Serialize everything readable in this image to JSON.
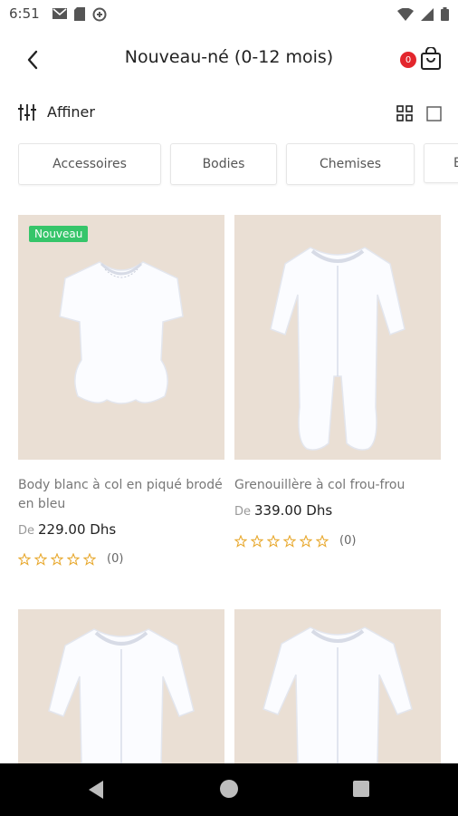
{
  "status_bar": {
    "time": "6:51"
  },
  "header": {
    "title": "Nouveau-né (0-12 mois)",
    "cart_count": "0"
  },
  "filter": {
    "label": "Affiner"
  },
  "chips": [
    "Accessoires",
    "Bodies",
    "Chemises",
    "B"
  ],
  "products": [
    {
      "badge": "Nouveau",
      "name": "Body blanc à col en piqué brodé en bleu",
      "price_prefix": "De",
      "price": "229.00 Dhs",
      "rating_count": "(0)"
    },
    {
      "badge": "",
      "name": "Grenouillère à col frou-frou",
      "price_prefix": "De",
      "price": "339.00 Dhs",
      "rating_count": "(0)"
    },
    {
      "badge": "",
      "name": "",
      "price_prefix": "",
      "price": "",
      "rating_count": ""
    },
    {
      "badge": "",
      "name": "",
      "price_prefix": "",
      "price": "",
      "rating_count": ""
    }
  ],
  "colors": {
    "accent_red": "#e3262d",
    "badge_green": "#36c56a",
    "star": "#e8a92f",
    "image_bg": "#eadfd4"
  }
}
